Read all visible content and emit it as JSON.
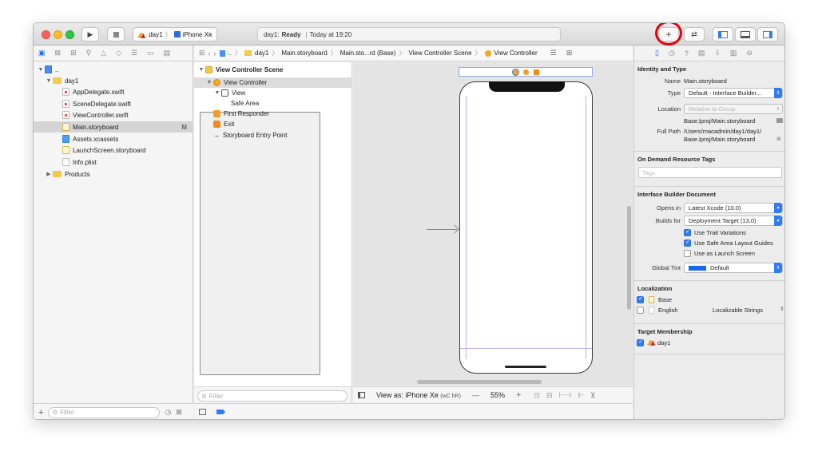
{
  "toolbar": {
    "scheme_target": "day1",
    "scheme_device": "iPhone Xʀ",
    "status_project": "day1:",
    "status_state": "Ready",
    "status_time": "Today at 19:20"
  },
  "navigator": {
    "root_label": "..",
    "items": [
      {
        "label": "day1"
      },
      {
        "label": "AppDelegate.swift"
      },
      {
        "label": "SceneDelegate.swift"
      },
      {
        "label": "ViewController.swift"
      },
      {
        "label": "Main.storyboard",
        "badge": "M"
      },
      {
        "label": "Assets.xcassets"
      },
      {
        "label": "LaunchScreen.storyboard"
      },
      {
        "label": "Info.plist"
      },
      {
        "label": "Products"
      }
    ],
    "filter_placeholder": "Filter"
  },
  "jumpbar": {
    "crumbs": [
      "..",
      "day1",
      "Main.storyboard",
      "Main.sto...rd (Base)",
      "View Controller Scene",
      "View Controller"
    ]
  },
  "outline": {
    "scene_title": "View Controller Scene",
    "items": [
      {
        "label": "View Controller"
      },
      {
        "label": "View"
      },
      {
        "label": "Safe Area"
      },
      {
        "label": "First Responder"
      },
      {
        "label": "Exit"
      },
      {
        "label": "Storyboard Entry Point"
      }
    ],
    "filter_placeholder": "Filter"
  },
  "canvas": {
    "view_as": "View as: iPhone Xʀ",
    "view_as_traits": "(wC hR)",
    "zoom": "55%",
    "minus": "—",
    "plus": "+"
  },
  "inspector": {
    "identity_title": "Identity and Type",
    "name_label": "Name",
    "name_value": "Main.storyboard",
    "type_label": "Type",
    "type_value": "Default - Interface Builder...",
    "location_label": "Location",
    "location_value": "Relative to Group",
    "location_file": "Base.lproj/Main.storyboard",
    "fullpath_label": "Full Path",
    "fullpath_line1": "/Users/macadmin/day1/day1/",
    "fullpath_line2": "Base.lproj/Main.storyboard",
    "ondemand_title": "On Demand Resource Tags",
    "tags_placeholder": "Tags",
    "ibdoc_title": "Interface Builder Document",
    "opens_in_label": "Opens in",
    "opens_in_value": "Latest Xcode (10.0)",
    "builds_for_label": "Builds for",
    "builds_for_value": "Deployment Target (13.0)",
    "checks": [
      {
        "label": "Use Trait Variations",
        "checked": true
      },
      {
        "label": "Use Safe Area Layout Guides",
        "checked": true
      },
      {
        "label": "Use as Launch Screen",
        "checked": false
      }
    ],
    "global_tint_label": "Global Tint",
    "global_tint_value": "Default",
    "localization_title": "Localization",
    "loc_base": "Base",
    "loc_english": "English",
    "loc_english_type": "Localizable Strings",
    "target_title": "Target Membership",
    "target_name": "day1"
  },
  "colors": {
    "accent": "#2f7cf6",
    "highlight_circle": "#e8000b"
  }
}
